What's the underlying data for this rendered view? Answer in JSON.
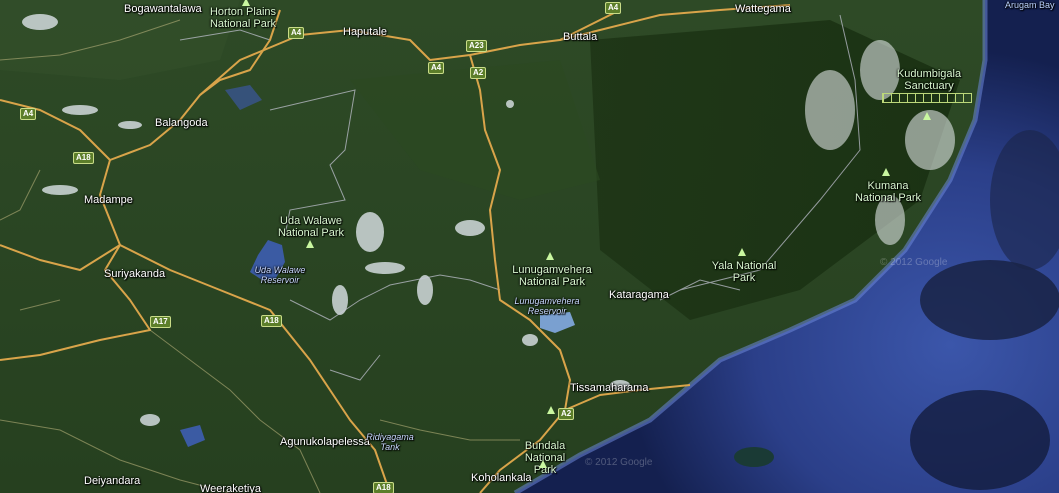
{
  "map": {
    "towns": [
      {
        "id": "bogawantalawa",
        "name": "Bogawantalawa"
      },
      {
        "id": "haputale",
        "name": "Haputale"
      },
      {
        "id": "buttala",
        "name": "Buttala"
      },
      {
        "id": "wattegama",
        "name": "Wattegama"
      },
      {
        "id": "balangoda",
        "name": "Balangoda"
      },
      {
        "id": "madampe",
        "name": "Madampe"
      },
      {
        "id": "suriyakanda",
        "name": "Suriyakanda"
      },
      {
        "id": "kataragama",
        "name": "Kataragama"
      },
      {
        "id": "tissamaharama",
        "name": "Tissamaharama"
      },
      {
        "id": "agunukolapelessa",
        "name": "Agunukolapelessa"
      },
      {
        "id": "deiyandara",
        "name": "Deiyandara"
      },
      {
        "id": "weeraketiya",
        "name": "Weeraketiya"
      },
      {
        "id": "koholankala",
        "name": "Koholankala"
      }
    ],
    "parks": [
      {
        "id": "horton-plains",
        "name": "Horton Plains National Park"
      },
      {
        "id": "uda-walawe",
        "name": "Uda Walawe National Park"
      },
      {
        "id": "lunugamvehera",
        "name": "Lunugamvehera National Park"
      },
      {
        "id": "yala",
        "name": "Yala National Park"
      },
      {
        "id": "kudumbigala",
        "name": "Kudumbigala Sanctuary"
      },
      {
        "id": "kumana",
        "name": "Kumana National Park"
      },
      {
        "id": "bundala",
        "name": "Bundala National Park"
      }
    ],
    "water": [
      {
        "id": "uda-walawe-reservoir",
        "name": "Uda Walawe Reservoir"
      },
      {
        "id": "lunugamvehera-reservoir",
        "name": "Lunugamvehera Reservoir"
      },
      {
        "id": "ridiyagama-tank",
        "name": "Ridiyagama Tank"
      },
      {
        "id": "arugam-bay",
        "name": "Arugam Bay"
      }
    ],
    "road_shields": [
      "A4",
      "A4",
      "A4",
      "A23",
      "A2",
      "A4",
      "A18",
      "A18",
      "A17",
      "A2",
      "A18"
    ],
    "watermarks": [
      "© 2012 Google",
      "© 2012 Google"
    ],
    "colors": {
      "land": "#2c4824",
      "road": "#d9a44a",
      "sea": "#2c3f86",
      "shore": "#1c2a5e",
      "park_text": "#d9f7d0",
      "boundary": "#c8c8d8"
    }
  }
}
